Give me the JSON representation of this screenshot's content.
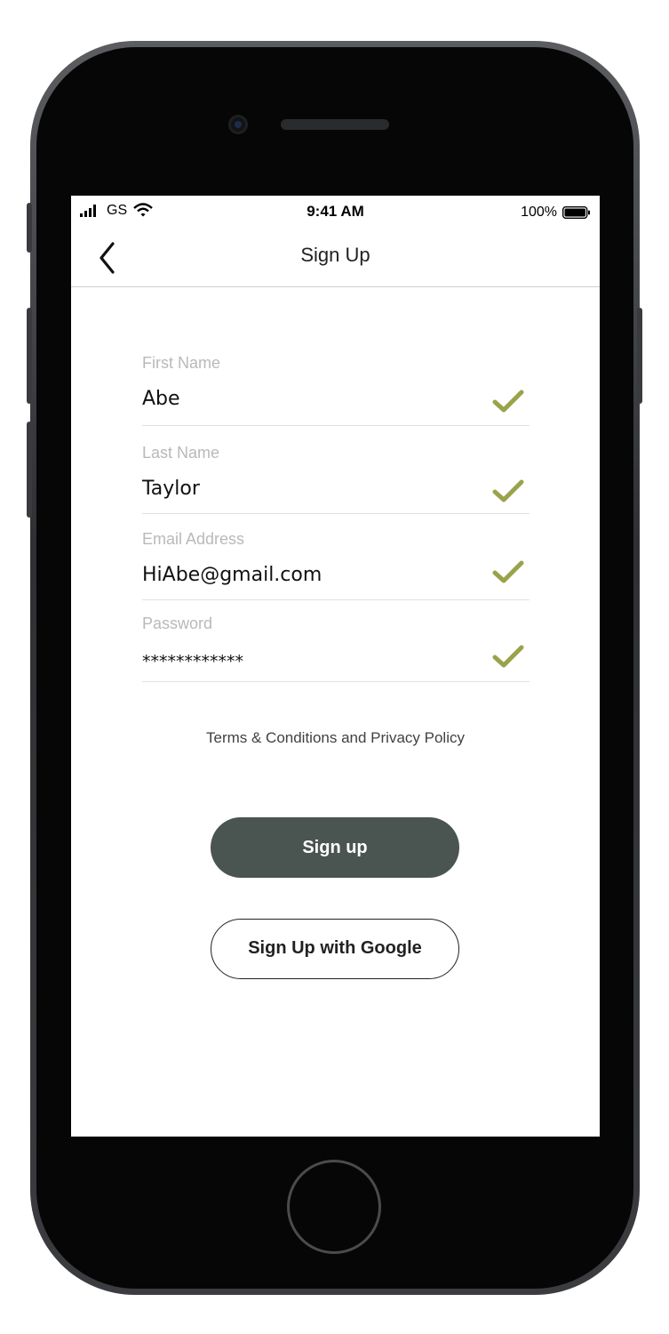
{
  "status_bar": {
    "carrier": "GS",
    "time": "9:41 AM",
    "battery_percent": "100%"
  },
  "nav": {
    "title": "Sign Up",
    "back_icon": "chevron-left-icon"
  },
  "form": {
    "fields": [
      {
        "label": "First Name",
        "value": "Abe",
        "valid": true
      },
      {
        "label": "Last Name",
        "value": "Taylor",
        "valid": true
      },
      {
        "label": "Email Address",
        "value": "HiAbe@gmail.com",
        "valid": true
      },
      {
        "label": "Password",
        "value": "************",
        "valid": true
      }
    ],
    "check_icon": "check-icon",
    "check_color": "#9aa34a"
  },
  "terms_link": "Terms & Conditions and Privacy Policy",
  "buttons": {
    "sign_up": "Sign up",
    "sign_up_google": "Sign Up with Google"
  },
  "colors": {
    "primary_button": "#4a5450",
    "accent_check": "#9aa34a"
  }
}
